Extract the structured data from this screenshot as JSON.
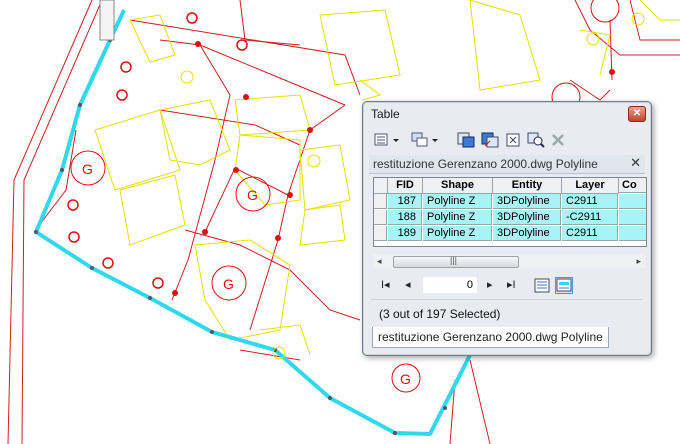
{
  "window": {
    "title": "Table",
    "close_glyph": "✕"
  },
  "toolbar": {
    "icons": [
      "table-options-icon",
      "related-tables-icon",
      "select-by-attributes-icon",
      "switch-selection-icon",
      "clear-selection-icon",
      "zoom-to-selected-icon",
      "delete-selected-icon"
    ]
  },
  "tab_header": {
    "title": "restituzione Gerenzano 2000.dwg Polyline",
    "close_glyph": "✕"
  },
  "grid": {
    "columns": [
      "FID",
      "Shape",
      "Entity",
      "Layer",
      "Co"
    ],
    "rows": [
      {
        "fid": "187",
        "shape": "Polyline Z",
        "entity": "3DPolyline",
        "layer": "C2911"
      },
      {
        "fid": "188",
        "shape": "Polyline Z",
        "entity": "3DPolyline",
        "layer": "-C2911"
      },
      {
        "fid": "189",
        "shape": "Polyline Z",
        "entity": "3DPolyline",
        "layer": "C2911"
      }
    ]
  },
  "scrollbar": {
    "left_arrow": "◂",
    "right_arrow": "▸",
    "grip": "|||"
  },
  "navigation": {
    "first": "I◂",
    "prev": "◂",
    "record": "0",
    "next": "▸",
    "last": "▸I"
  },
  "selection_info": "(3 out of 197 Selected)",
  "bottom_tab": "restituzione Gerenzano 2000.dwg Polyline",
  "colors": {
    "selected_row": "#a6f4f6",
    "highlight_line": "#2fd8ea",
    "parcel_line": "#cc2020",
    "building_line": "#e6e000"
  }
}
